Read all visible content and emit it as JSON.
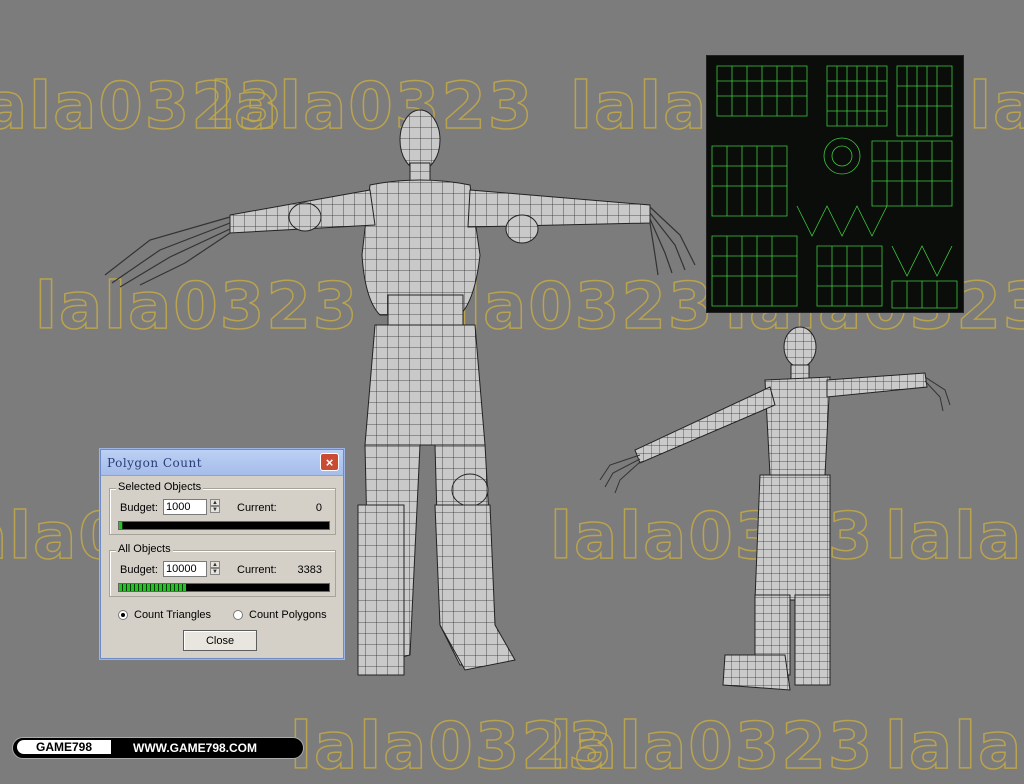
{
  "watermark": {
    "text": "lala0323"
  },
  "dialog": {
    "title": "Polygon Count",
    "close_icon": "×",
    "selected": {
      "legend": "Selected Objects",
      "budget_label": "Budget:",
      "budget_value": "1000",
      "current_label": "Current:",
      "current_value": "0",
      "progress_fraction": 0.02
    },
    "all": {
      "legend": "All Objects",
      "budget_label": "Budget:",
      "budget_value": "10000",
      "current_label": "Current:",
      "current_value": "3383",
      "progress_fraction": 0.32
    },
    "count_triangles": "Count Triangles",
    "count_polygons": "Count Polygons",
    "close_label": "Close"
  },
  "footer": {
    "brand": "GAME798",
    "url": "WWW.GAME798.COM"
  },
  "colors": {
    "background": "#7c7c7c",
    "watermark": "#c4aa46",
    "uv_wire": "#3ec83e"
  },
  "icons": {
    "spinner_up": "▲",
    "spinner_down": "▼"
  }
}
